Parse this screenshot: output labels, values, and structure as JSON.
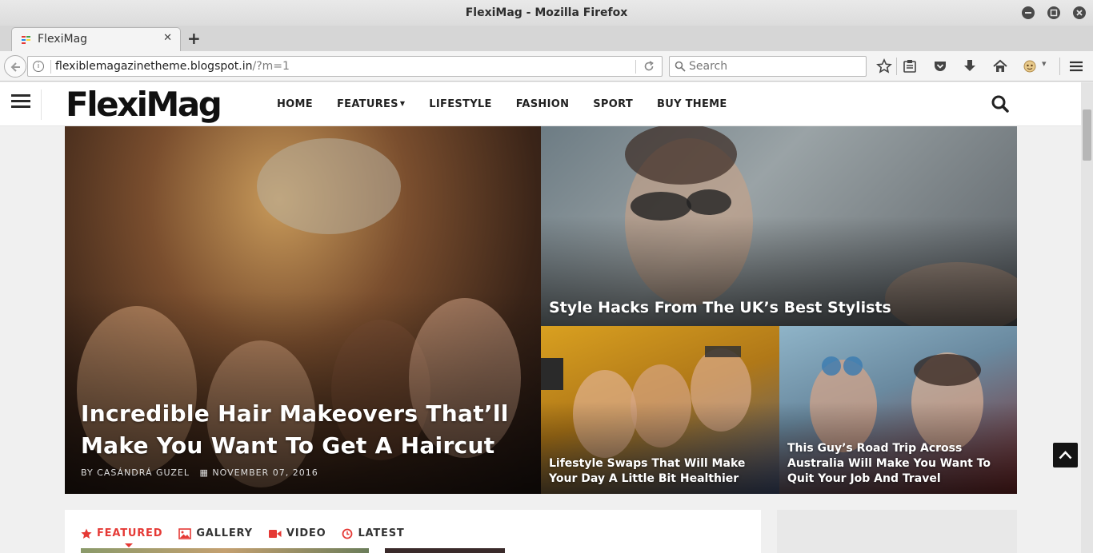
{
  "window": {
    "title": "FlexiMag - Mozilla Firefox",
    "buttons": {
      "minimize": "minimize-icon",
      "maximize": "maximize-icon",
      "close": "close-icon"
    }
  },
  "tab": {
    "title": "FlexiMag",
    "favicon_colors": [
      "#e53935",
      "#43a047",
      "#1e88e5",
      "#fdd835"
    ]
  },
  "navbar": {
    "url_host": "flexiblemagazinetheme.blogspot.in",
    "url_path": "/?m=1",
    "search_placeholder": "Search",
    "toolbar_icons": [
      "bookmark-star-icon",
      "reading-list-icon",
      "pocket-icon",
      "download-icon",
      "home-icon",
      "extension-icon",
      "menu-icon"
    ]
  },
  "site": {
    "logo": "FlexiMag",
    "menu": [
      {
        "label": "HOME",
        "has_dropdown": false
      },
      {
        "label": "FEATURES",
        "has_dropdown": true
      },
      {
        "label": "LIFESTYLE",
        "has_dropdown": false
      },
      {
        "label": "FASHION",
        "has_dropdown": false
      },
      {
        "label": "SPORT",
        "has_dropdown": false
      },
      {
        "label": "BUY THEME",
        "has_dropdown": false
      }
    ],
    "accent_color": "#e53935"
  },
  "hero": {
    "main": {
      "title": "Incredible Hair Makeovers That’ll Make You Want To Get A Haircut",
      "author": "BY CASÁNDRÁ GUZEL",
      "date": "NOVEMBER 07, 2016"
    },
    "top_right": {
      "title": "Style Hacks From The UK’s Best Stylists"
    },
    "bottom_left": {
      "title": "Lifestyle Swaps That Will Make Your Day A Little Bit Healthier"
    },
    "bottom_right": {
      "title": "This Guy’s Road Trip Across Australia Will Make You Want To Quit Your Job And Travel"
    }
  },
  "post_tabs": [
    {
      "label": "FEATURED",
      "icon": "star-icon",
      "active": true
    },
    {
      "label": "GALLERY",
      "icon": "image-icon",
      "active": false
    },
    {
      "label": "VIDEO",
      "icon": "video-camera-icon",
      "active": false
    },
    {
      "label": "LATEST",
      "icon": "clock-icon",
      "active": false
    }
  ]
}
